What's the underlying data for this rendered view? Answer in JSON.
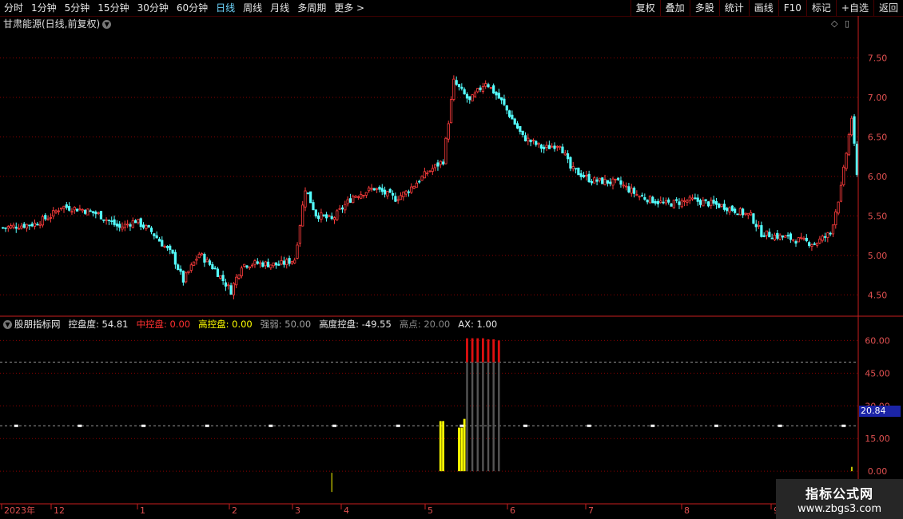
{
  "toolbar": {
    "periods": [
      "分时",
      "1分钟",
      "5分钟",
      "15分钟",
      "30分钟",
      "60分钟",
      "日线",
      "周线",
      "月线",
      "多周期",
      "更多 >"
    ],
    "active_period": "日线",
    "tools": [
      "复权",
      "叠加",
      "多股",
      "统计",
      "画线",
      "F10",
      "标记",
      "+自选",
      "返回"
    ]
  },
  "stock": {
    "title": "甘肃能源(日线,前复权)"
  },
  "indicator": {
    "name": "股朋指标网",
    "items": [
      {
        "label": "控盘度: 54.81",
        "color": "#e6e6e6"
      },
      {
        "label": "中控盘: 0.00",
        "color": "#ff3030"
      },
      {
        "label": "高控盘: 0.00",
        "color": "#ffff00"
      },
      {
        "label": "强弱: 50.00",
        "color": "#a0a0a0"
      },
      {
        "label": "高度控盘: -49.55",
        "color": "#e6e6e6"
      },
      {
        "label": "高点: 20.00",
        "color": "#888888"
      },
      {
        "label": "AX: 1.00",
        "color": "#e6e6e6"
      }
    ],
    "current_value": "20.84"
  },
  "colors": {
    "up": "#ff3c3c",
    "down": "#54ffff",
    "grid": "#8a0000",
    "axis": "#c81e1e",
    "label": "#e05050"
  },
  "chart_data": [
    {
      "type": "candlestick",
      "ylim": [
        4.25,
        7.85
      ],
      "yticks": [
        4.5,
        5.0,
        5.5,
        6.0,
        6.5,
        7.0,
        7.5
      ],
      "tick_labels": [
        "4.50",
        "5.00",
        "5.50",
        "6.00",
        "6.50",
        "7.00",
        "7.50"
      ],
      "anchors": [
        [
          0,
          5.35
        ],
        [
          12,
          5.4
        ],
        [
          18,
          5.5
        ],
        [
          22,
          5.62
        ],
        [
          30,
          5.58
        ],
        [
          36,
          5.52
        ],
        [
          44,
          5.35
        ],
        [
          50,
          5.44
        ],
        [
          56,
          5.3
        ],
        [
          64,
          5.0
        ],
        [
          68,
          4.68
        ],
        [
          74,
          5.02
        ],
        [
          80,
          4.82
        ],
        [
          86,
          4.55
        ],
        [
          90,
          4.88
        ],
        [
          96,
          4.9
        ],
        [
          104,
          4.88
        ],
        [
          110,
          4.95
        ],
        [
          114,
          5.85
        ],
        [
          118,
          5.52
        ],
        [
          124,
          5.45
        ],
        [
          132,
          5.75
        ],
        [
          140,
          5.85
        ],
        [
          148,
          5.72
        ],
        [
          152,
          5.8
        ],
        [
          160,
          6.05
        ],
        [
          166,
          6.2
        ],
        [
          170,
          7.2
        ],
        [
          176,
          6.95
        ],
        [
          182,
          7.2
        ],
        [
          188,
          6.95
        ],
        [
          196,
          6.5
        ],
        [
          204,
          6.35
        ],
        [
          210,
          6.42
        ],
        [
          214,
          6.1
        ],
        [
          222,
          5.95
        ],
        [
          232,
          5.92
        ],
        [
          240,
          5.75
        ],
        [
          250,
          5.65
        ],
        [
          260,
          5.7
        ],
        [
          272,
          5.62
        ],
        [
          282,
          5.5
        ],
        [
          286,
          5.28
        ],
        [
          296,
          5.22
        ],
        [
          306,
          5.15
        ],
        [
          312,
          5.28
        ],
        [
          316,
          5.85
        ],
        [
          320,
          6.75
        ],
        [
          322,
          6.0
        ]
      ],
      "n_candles": 323,
      "x_tick_labels": [
        "2023年",
        "12",
        "1",
        "2",
        "3",
        "4",
        "5",
        "6",
        "7",
        "8",
        "9"
      ]
    },
    {
      "type": "bar",
      "ylim": [
        -8,
        66
      ],
      "yticks": [
        0,
        15,
        30,
        45,
        60
      ],
      "tick_labels": [
        "0.00",
        "15.00",
        "30.00",
        "45.00",
        "60.00"
      ],
      "dashed_lines": [
        50,
        20.84
      ],
      "yellow_bars": [
        [
          165,
          23
        ],
        [
          166,
          23
        ],
        [
          172,
          20
        ],
        [
          173,
          20
        ],
        [
          174,
          24
        ]
      ],
      "gray_bars": [
        [
          175,
          50
        ],
        [
          177,
          50
        ],
        [
          179,
          50
        ],
        [
          181,
          50
        ],
        [
          183,
          50
        ],
        [
          185,
          50
        ],
        [
          187,
          50
        ]
      ],
      "red_caps": [
        [
          175,
          50,
          61
        ],
        [
          177,
          50,
          61
        ],
        [
          179,
          50,
          61
        ],
        [
          181,
          50,
          61
        ],
        [
          183,
          50,
          60.5
        ],
        [
          185,
          50,
          60.5
        ],
        [
          187,
          50,
          60
        ]
      ],
      "markers_value": 20.84,
      "markers_every": 12,
      "tail_bar": [
        320,
        0,
        2
      ]
    }
  ]
}
